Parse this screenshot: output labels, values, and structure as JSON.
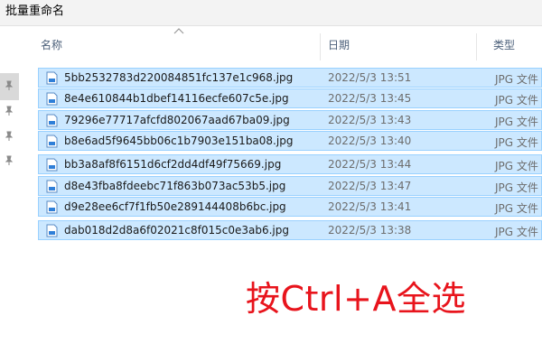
{
  "window": {
    "title": "批量重命名"
  },
  "nav": {
    "pins": [
      "pin-icon",
      "pin-icon",
      "pin-icon",
      "pin-icon"
    ]
  },
  "columns": {
    "name": "名称",
    "date": "日期",
    "type": "类型"
  },
  "files": [
    {
      "name": "5bb2532783d220084851fc137e1c968.jpg",
      "date": "2022/5/3 13:51",
      "type": "JPG 文件"
    },
    {
      "name": "8e4e610844b1dbef14116ecfe607c5e.jpg",
      "date": "2022/5/3 13:45",
      "type": "JPG 文件"
    },
    {
      "name": "79296e77717afcfd802067aad67ba09.jpg",
      "date": "2022/5/3 13:43",
      "type": "JPG 文件"
    },
    {
      "name": "b8e6ad5f9645bb06c1b7903e151ba08.jpg",
      "date": "2022/5/3 13:40",
      "type": "JPG 文件"
    },
    {
      "name": "bb3a8af8f6151d6cf2dd4df49f75669.jpg",
      "date": "2022/5/3 13:44",
      "type": "JPG 文件"
    },
    {
      "name": "d8e43fba8fdeebc71f863b073ac53b5.jpg",
      "date": "2022/5/3 13:47",
      "type": "JPG 文件"
    },
    {
      "name": "d9e28ee6cf7f1fb50e289144408b6bc.jpg",
      "date": "2022/5/3 13:41",
      "type": "JPG 文件"
    },
    {
      "name": "dab018d2d8a6f02021c8f015c0e3ab6.jpg",
      "date": "2022/5/3 13:38",
      "type": "JPG 文件"
    }
  ],
  "annotation": {
    "text": "按Ctrl+A全选",
    "color": "#e8141c"
  },
  "colors": {
    "selection": "#cce8ff",
    "selection_border": "#99d1ff",
    "header_text": "#4c607a"
  }
}
